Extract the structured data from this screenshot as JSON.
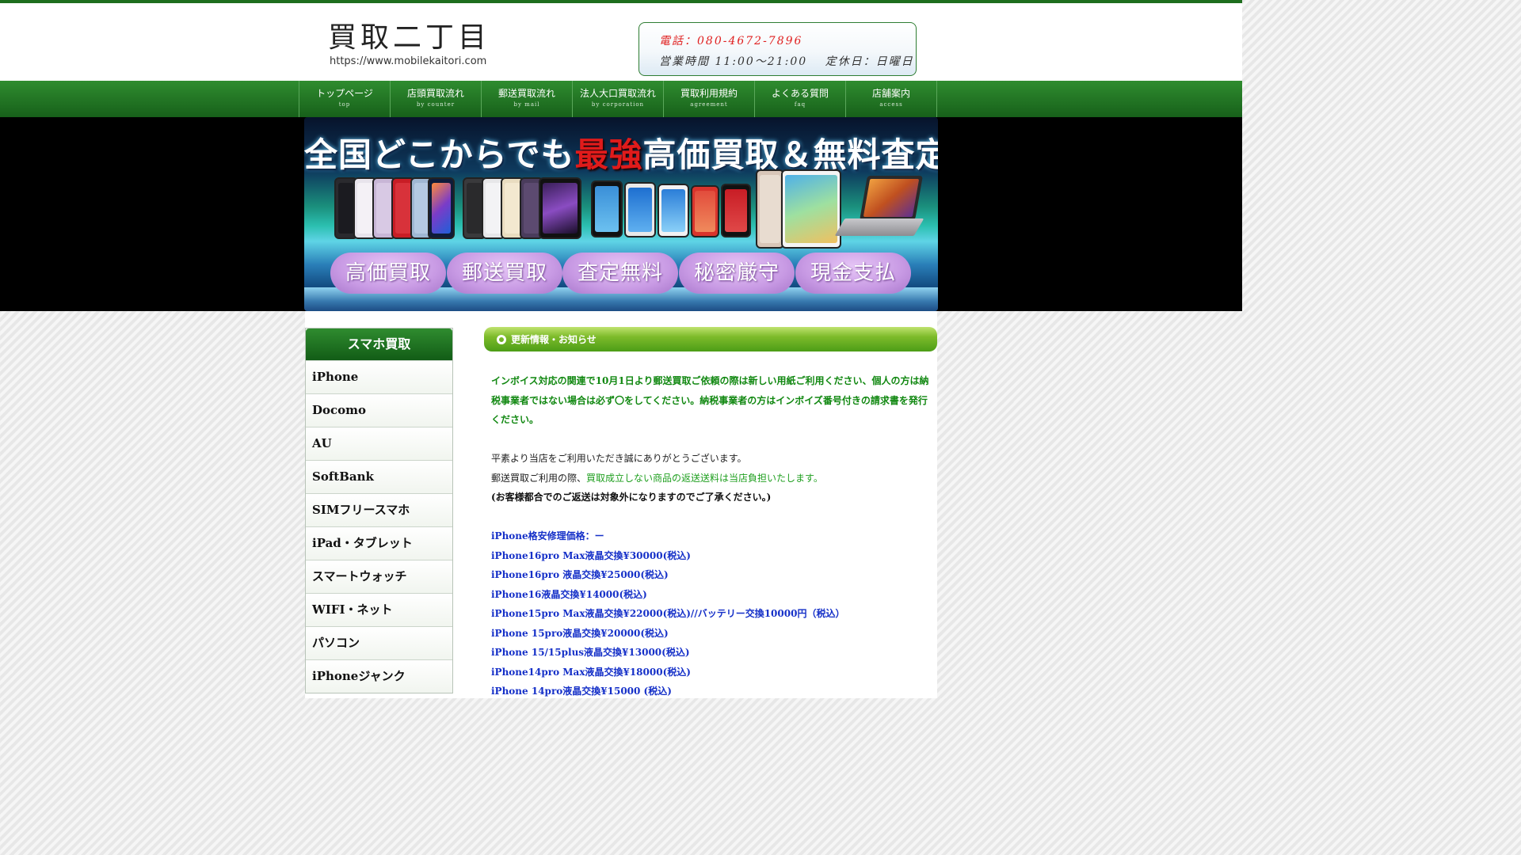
{
  "header": {
    "logo_title": "買取二丁目",
    "logo_url": "https://www.mobilekaitori.com",
    "phone": "電話：080-4672-7896",
    "hours": "営業時間 11:00～21:00　 定休日：日曜日"
  },
  "nav": [
    {
      "label": "トップページ",
      "sub": "top"
    },
    {
      "label": "店頭買取流れ",
      "sub": "by counter"
    },
    {
      "label": "郵送買取流れ",
      "sub": "by mail"
    },
    {
      "label": "法人大口買取流れ",
      "sub": "by corporation"
    },
    {
      "label": "買取利用規約",
      "sub": "agreement"
    },
    {
      "label": "よくある質問",
      "sub": "faq"
    },
    {
      "label": "店舗案内",
      "sub": "access"
    }
  ],
  "banner": {
    "title_pre": "全国どこからでも",
    "title_highlight": "最強",
    "title_post": "高価買取＆無料査定",
    "badges": [
      "高価買取",
      "郵送買取",
      "査定無料",
      "秘密厳守",
      "現金支払"
    ]
  },
  "sidebar": {
    "title": "スマホ買取",
    "items": [
      "iPhone",
      "Docomo",
      "AU",
      "SoftBank",
      "SIMフリースマホ",
      "iPad・タブレット",
      "スマートウォッチ",
      "WIFI・ネット",
      "パソコン",
      "iPhoneジャンク"
    ]
  },
  "news": {
    "title": "更新情報・お知らせ",
    "notice": "インボイス対応の関連で10月1日より郵送買取ご依頼の際は新しい用紙ご利用ください、個人の方は納税事業者ではない場合は必ず〇をしてください。納税事業者の方はインボイズ番号付きの請求書を発行ください。",
    "thanks": "平素より当店をご利用いただき誠にありがとうございます。",
    "mail_prefix": "郵送買取ご利用の際、",
    "mail_highlight": "買取成立しない商品の返送送料は当店負担いたします。",
    "exception": "(お客様都合でのご返送は対象外になりますのでご了承ください。)",
    "repair_title": "iPhone格安修理価格：ー",
    "repair_items": [
      "iPhone16pro Max液晶交換¥30000(税込)",
      "iPhone16pro 液晶交換¥25000(税込)",
      "iPhone16液晶交換¥14000(税込)",
      "iPhone15pro Max液晶交換¥22000(税込)//バッテリー交換10000円（税込）",
      "iPhone 15pro液晶交換¥20000(税込)",
      "iPhone 15/15plus液晶交換¥13000(税込)",
      "iPhone14pro Max液晶交換¥18000(税込)",
      "iPhone 14pro液晶交換¥15000 (税込)"
    ]
  },
  "colors": {
    "brand_green": "#1e6e1e",
    "notice_green": "#118811",
    "price_blue": "#1530c8",
    "phone_red": "#e02020",
    "badge_purple": "#c89ae4"
  }
}
